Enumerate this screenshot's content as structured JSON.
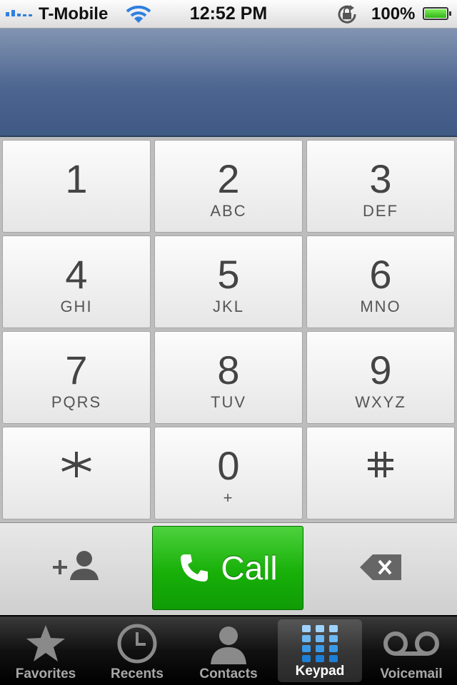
{
  "status_bar": {
    "carrier": "T-Mobile",
    "time": "12:52 PM",
    "battery": "100%",
    "icons": [
      "signal-icon",
      "wifi-icon",
      "rotation-lock-icon",
      "battery-icon"
    ]
  },
  "display": {
    "number": ""
  },
  "keypad": {
    "keys": [
      {
        "digit": "1",
        "letters": ""
      },
      {
        "digit": "2",
        "letters": "ABC"
      },
      {
        "digit": "3",
        "letters": "DEF"
      },
      {
        "digit": "4",
        "letters": "GHI"
      },
      {
        "digit": "5",
        "letters": "JKL"
      },
      {
        "digit": "6",
        "letters": "MNO"
      },
      {
        "digit": "7",
        "letters": "PQRS"
      },
      {
        "digit": "8",
        "letters": "TUV"
      },
      {
        "digit": "9",
        "letters": "WXYZ"
      },
      {
        "digit": "*",
        "letters": ""
      },
      {
        "digit": "0",
        "letters": "+"
      },
      {
        "digit": "#",
        "letters": ""
      }
    ]
  },
  "actions": {
    "call_label": "Call",
    "add_contact_icon": "add-contact-icon",
    "backspace_icon": "backspace-icon",
    "call_color": "#18b009"
  },
  "tabs": [
    {
      "label": "Favorites",
      "icon": "star-icon",
      "active": false
    },
    {
      "label": "Recents",
      "icon": "clock-icon",
      "active": false
    },
    {
      "label": "Contacts",
      "icon": "person-icon",
      "active": false
    },
    {
      "label": "Keypad",
      "icon": "keypad-icon",
      "active": true
    },
    {
      "label": "Voicemail",
      "icon": "voicemail-icon",
      "active": false
    }
  ]
}
